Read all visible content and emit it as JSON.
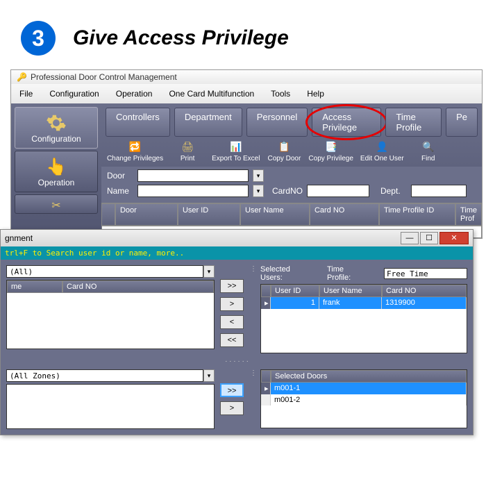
{
  "step": {
    "number": "3",
    "title": "Give Access Privilege"
  },
  "window": {
    "title": "Professional Door Control Management"
  },
  "menu": [
    "File",
    "Configuration",
    "Operation",
    "One Card Multifunction",
    "Tools",
    "Help"
  ],
  "sidebar": {
    "items": [
      {
        "label": "Configuration"
      },
      {
        "label": "Operation"
      }
    ]
  },
  "tabs": [
    "Controllers",
    "Department",
    "Personnel",
    "Access Privilege",
    "Time Profile",
    "Pe"
  ],
  "toolbar": [
    {
      "label": "Change Privileges"
    },
    {
      "label": "Print"
    },
    {
      "label": "Export To Excel"
    },
    {
      "label": "Copy Door"
    },
    {
      "label": "Copy Privilege"
    },
    {
      "label": "Edit One User"
    },
    {
      "label": "Find"
    }
  ],
  "filters": {
    "door_label": "Door",
    "name_label": "Name",
    "cardno_label": "CardNO",
    "dept_label": "Dept."
  },
  "grid_cols": [
    "Door",
    "User ID",
    "User Name",
    "Card NO",
    "Time Profile ID",
    "Time Prof"
  ],
  "dialog": {
    "title": "gnment",
    "hint": "trl+F  to Search user id or name,  more..",
    "left_filter1": "(All)",
    "left_filter2": "(All Zones)",
    "left_grid_cols": [
      "me",
      "Card NO"
    ],
    "selected_users_label": "Selected Users:",
    "time_profile_label": "Time Profile:",
    "time_profile_value": "Free Time",
    "users_cols": [
      "User ID",
      "User Name",
      "Card NO"
    ],
    "users_row": {
      "id": "1",
      "name": "frank",
      "card": "1319900"
    },
    "selected_doors_label": "Selected Doors",
    "doors": [
      "m001-1",
      "m001-2"
    ],
    "arrows": {
      "add_all": ">>",
      "add_one": ">",
      "remove_one": "<",
      "remove_all": "<<"
    }
  }
}
